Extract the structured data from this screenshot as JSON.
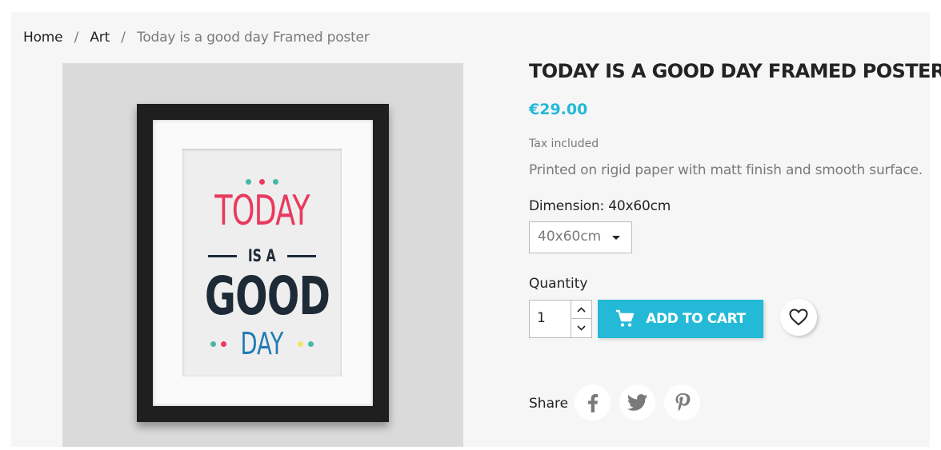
{
  "breadcrumb": {
    "items": [
      "Home",
      "Art"
    ],
    "separator": "/",
    "current": "Today is a good day Framed poster"
  },
  "product_image": {
    "alt": "Today is a good day framed poster",
    "poster_text": {
      "line1": "TODAY",
      "line2": "IS A",
      "line3": "GOOD",
      "line4": "DAY"
    }
  },
  "product": {
    "title": "TODAY IS A GOOD DAY FRAMED POSTER",
    "price": "€29.00",
    "tax_note": "Tax included",
    "description": "Printed on rigid paper with matt finish and smooth surface."
  },
  "dimension": {
    "label": "Dimension: 40x60cm",
    "selected": "40x60cm"
  },
  "quantity": {
    "label": "Quantity",
    "value": "1"
  },
  "actions": {
    "add_to_cart": "ADD TO CART"
  },
  "share": {
    "label": "Share",
    "icons": [
      "facebook-icon",
      "twitter-icon",
      "pinterest-icon"
    ]
  },
  "colors": {
    "accent": "#24b9d7",
    "text_dark": "#232323",
    "text_muted": "#7a7a7a",
    "poster_pink": "#e83a5e",
    "poster_navy": "#1f2a37",
    "poster_blue": "#1f7bb3",
    "poster_teal": "#49b8a6",
    "poster_yellow": "#f1e26b"
  }
}
